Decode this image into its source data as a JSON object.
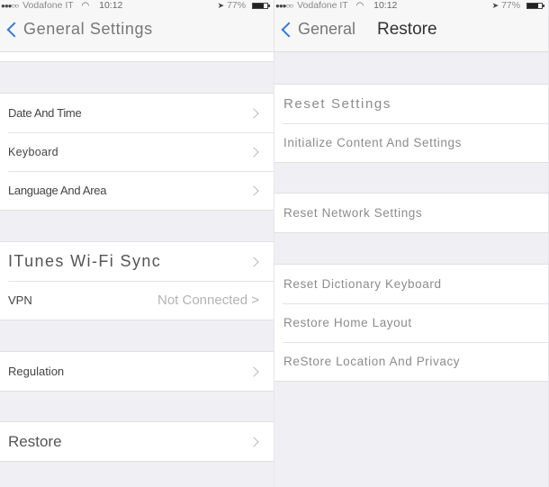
{
  "left_screen": {
    "status_bar": {
      "signal_dots": "●●●○○",
      "carrier": "Vodafone IT",
      "wifi_icon": "wifi-icon",
      "time": "10:12",
      "location_icon": "location-arrow-icon",
      "battery_percent": "77%",
      "battery_level": 0.77
    },
    "nav": {
      "back_label": "General Settings",
      "back_icon": "chevron-left-icon"
    },
    "groups": [
      {
        "rows": [
          {
            "label": "Date And Time",
            "chevron": true
          },
          {
            "label": "Keyboard",
            "chevron": true
          },
          {
            "label": "Language And Area",
            "chevron": true
          }
        ]
      },
      {
        "rows": [
          {
            "label": "ITunes Wi-Fi Sync",
            "chevron": true
          },
          {
            "label": "VPN",
            "value": "Not Connected >"
          }
        ]
      },
      {
        "rows": [
          {
            "label": "Regulation",
            "chevron": true
          }
        ]
      },
      {
        "rows": [
          {
            "label": "Restore",
            "chevron": true
          }
        ]
      }
    ]
  },
  "right_screen": {
    "status_bar": {
      "signal_dots": "●●●○○",
      "carrier": "Vodafone IT",
      "wifi_icon": "wifi-icon",
      "time": "10:12",
      "location_icon": "location-arrow-icon",
      "battery_percent": "77%",
      "battery_level": 0.77
    },
    "nav": {
      "back_label": "General",
      "back_icon": "chevron-left-icon",
      "title": "Restore"
    },
    "groups": [
      {
        "rows": [
          {
            "label": "Reset Settings"
          },
          {
            "label": "Initialize Content And Settings"
          }
        ]
      },
      {
        "rows": [
          {
            "label": "Reset Network Settings"
          }
        ]
      },
      {
        "rows": [
          {
            "label": "Reset Dictionary Keyboard"
          },
          {
            "label": "Restore Home Layout"
          },
          {
            "label": "ReStore Location And Privacy"
          }
        ]
      }
    ]
  }
}
